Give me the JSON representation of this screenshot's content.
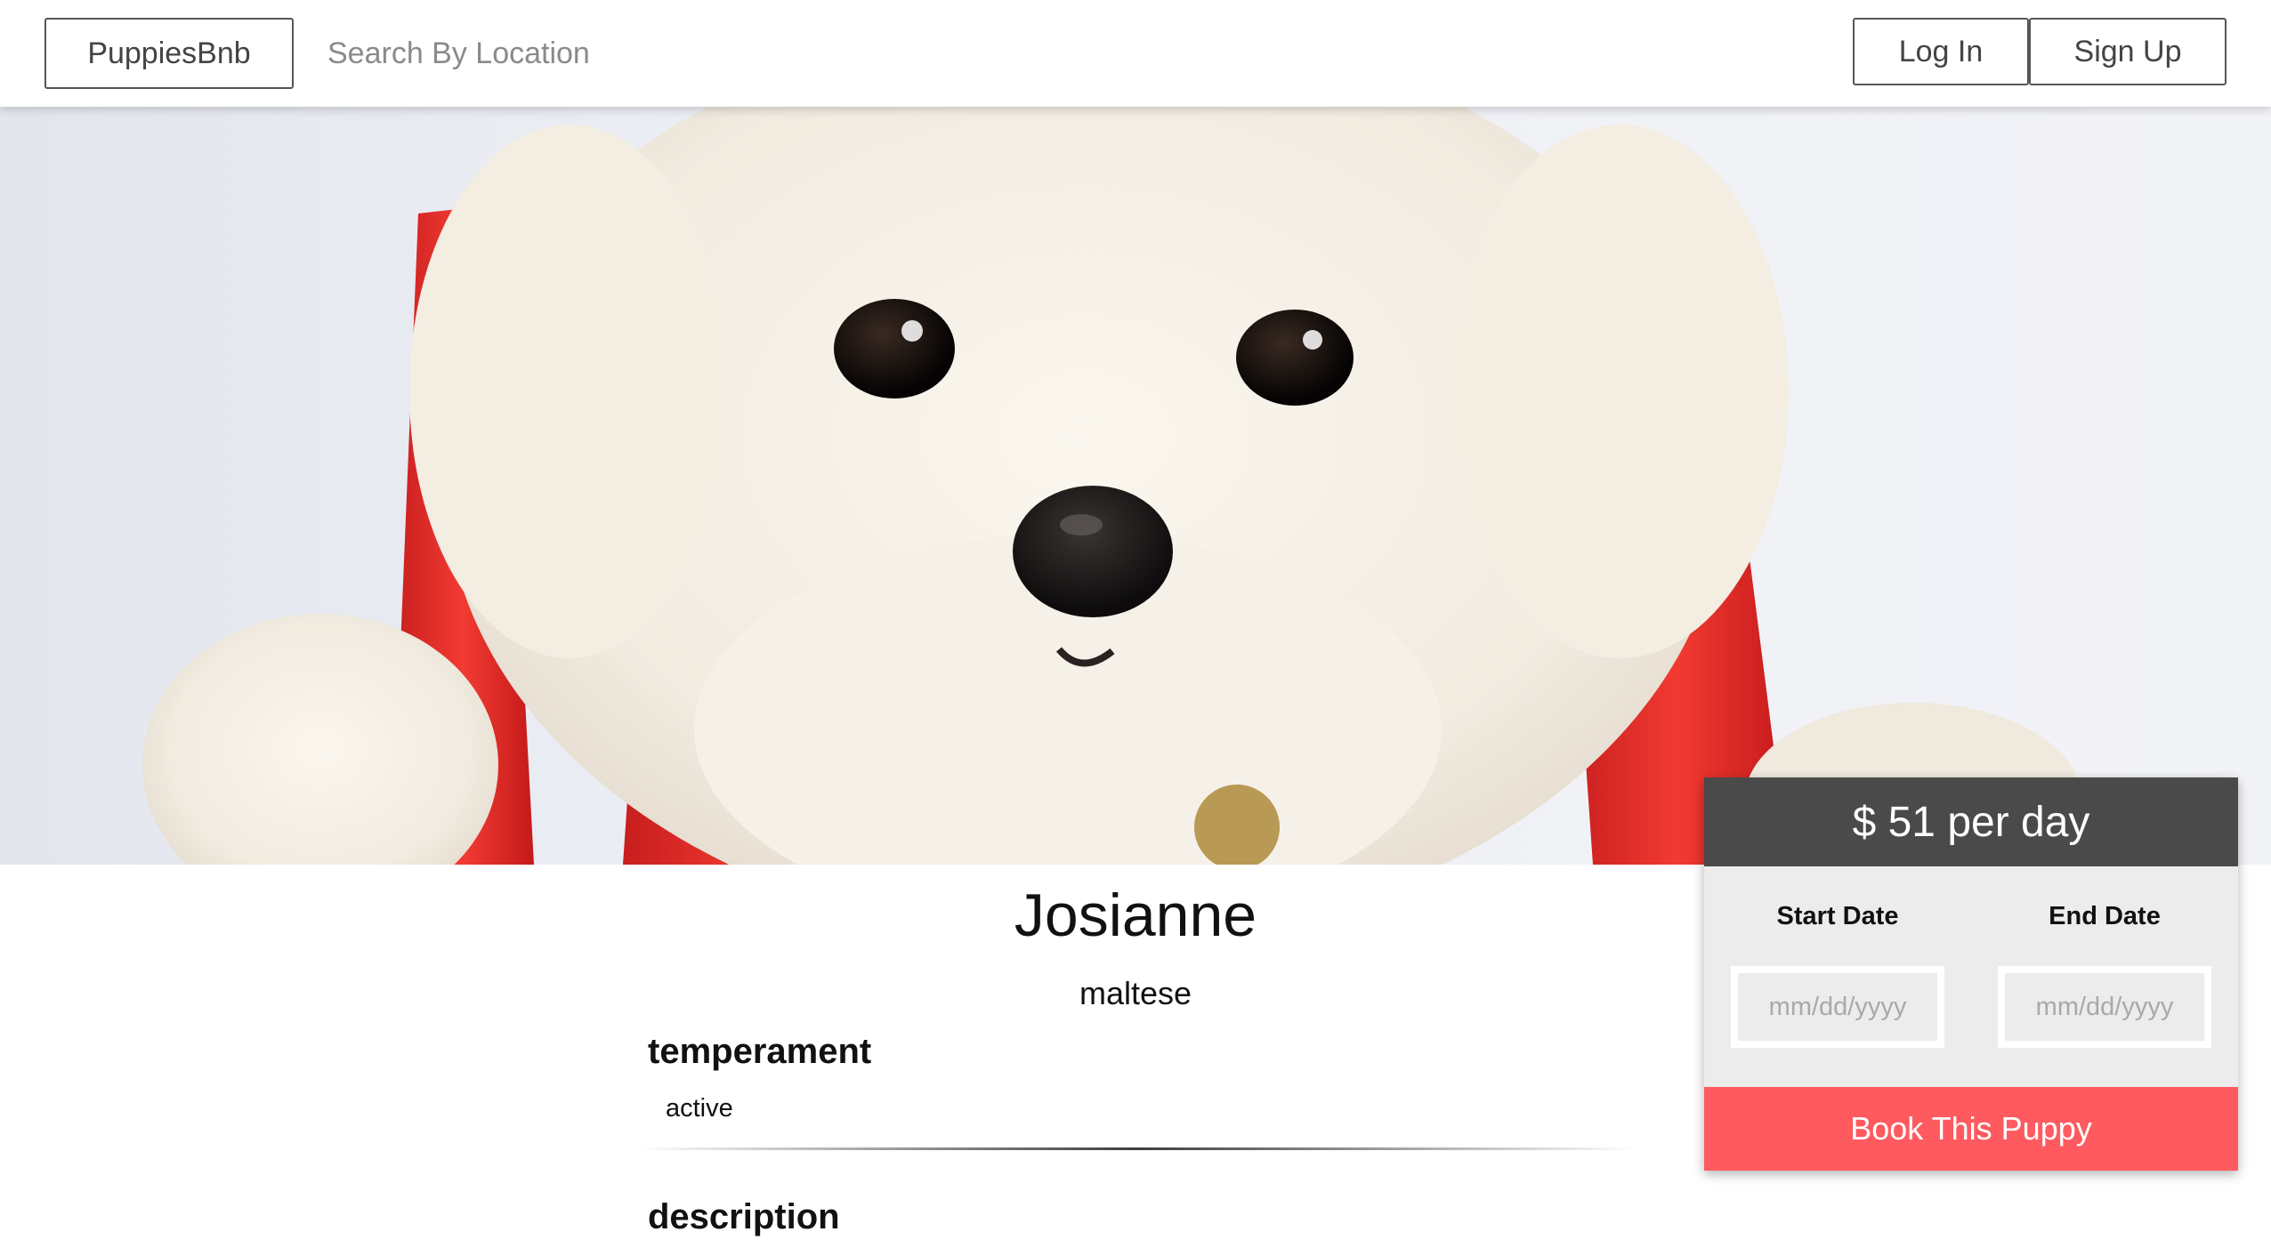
{
  "header": {
    "brand": "PuppiesBnb",
    "search_placeholder": "Search By Location",
    "login_label": "Log In",
    "signup_label": "Sign Up"
  },
  "listing": {
    "name": "Josianne",
    "breed": "maltese",
    "temperament_heading": "temperament",
    "temperament_value": "active",
    "description_heading": "description"
  },
  "booking": {
    "price_text": "$ 51 per day",
    "start_label": "Start Date",
    "end_label": "End Date",
    "date_placeholder": "mm/dd/yyyy",
    "book_label": "Book This Puppy"
  },
  "colors": {
    "accent": "#ff5a5f",
    "price_bar": "#4a4a4a",
    "panel_bg": "#ececec"
  }
}
